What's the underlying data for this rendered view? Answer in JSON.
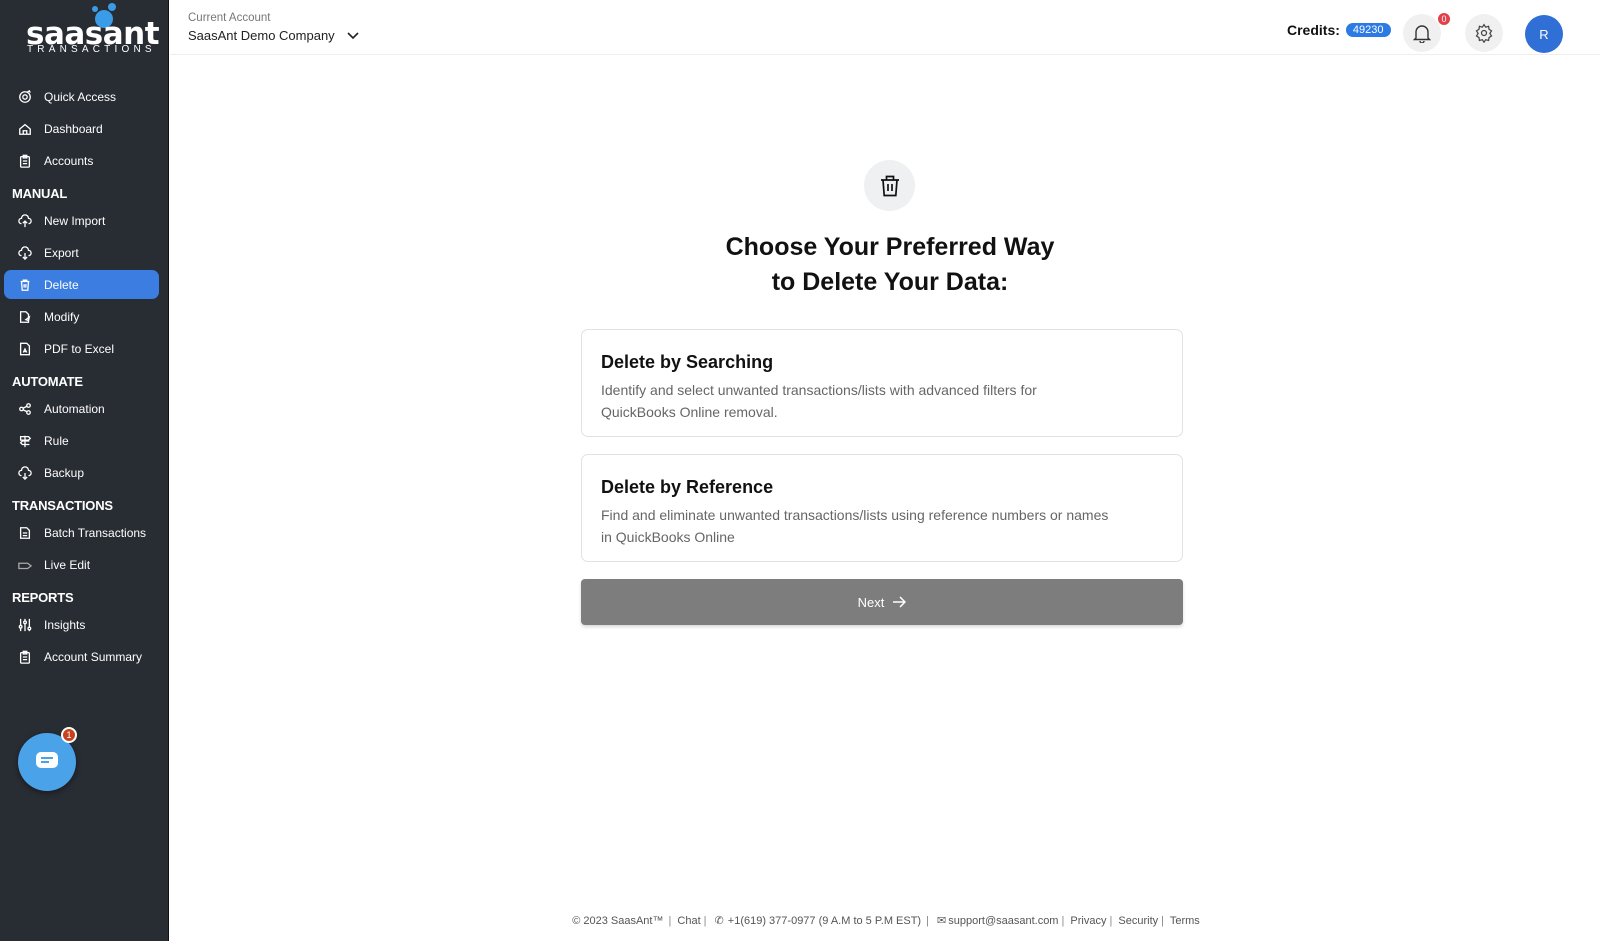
{
  "brand": {
    "logo_word": "saasant",
    "logo_sub": "TRANSACTIONS",
    "accent": "#3a9be6"
  },
  "sidebar": {
    "items_top": [
      {
        "label": "Quick Access",
        "icon": "target-icon"
      },
      {
        "label": "Dashboard",
        "icon": "home-icon"
      },
      {
        "label": "Accounts",
        "icon": "clipboard-icon"
      }
    ],
    "sections": {
      "manual": "MANUAL",
      "automate": "AUTOMATE",
      "transactions": "TRANSACTIONS",
      "reports": "REPORTS"
    },
    "manual_items": [
      {
        "label": "New Import",
        "icon": "cloud-upload-icon"
      },
      {
        "label": "Export",
        "icon": "cloud-download-icon"
      },
      {
        "label": "Delete",
        "icon": "trash-icon",
        "active": true
      },
      {
        "label": "Modify",
        "icon": "file-edit-icon"
      },
      {
        "label": "PDF to Excel",
        "icon": "pdf-file-icon"
      }
    ],
    "automate_items": [
      {
        "label": "Automation",
        "icon": "share-nodes-icon"
      },
      {
        "label": "Rule",
        "icon": "signpost-icon"
      },
      {
        "label": "Backup",
        "icon": "cloud-backup-icon"
      }
    ],
    "transactions_items": [
      {
        "label": "Batch Transactions",
        "icon": "document-icon"
      },
      {
        "label": "Live Edit",
        "icon": "pencil-tag-icon"
      }
    ],
    "reports_items": [
      {
        "label": "Insights",
        "icon": "sliders-icon"
      },
      {
        "label": "Account Summary",
        "icon": "clipboard-list-icon"
      }
    ],
    "chat_badge": "1",
    "active_color": "#3b7de0"
  },
  "header": {
    "account_label": "Current Account",
    "account_name": "SaasAnt Demo Company",
    "credits_label": "Credits:",
    "credits_value": "49230",
    "notifications_count": "0",
    "avatar_initial": "R"
  },
  "main": {
    "title_line1": "Choose Your Preferred Way",
    "title_line2": "to Delete Your Data:",
    "options": [
      {
        "title": "Delete by Searching",
        "desc_line1": "Identify and select unwanted transactions/lists with advanced filters for",
        "desc_line2": "QuickBooks Online removal."
      },
      {
        "title": "Delete by Reference",
        "desc_line1": "Find and eliminate unwanted transactions/lists using reference numbers or names",
        "desc_line2": "in QuickBooks Online"
      }
    ],
    "next_label": "Next"
  },
  "footer": {
    "copyright": "© 2023 SaasAnt™",
    "chat": "Chat",
    "phone": "+1(619) 377-0977 (9 A.M to 5 P.M EST)",
    "email": "support@saasant.com",
    "privacy": "Privacy",
    "security": "Security",
    "terms": "Terms"
  }
}
